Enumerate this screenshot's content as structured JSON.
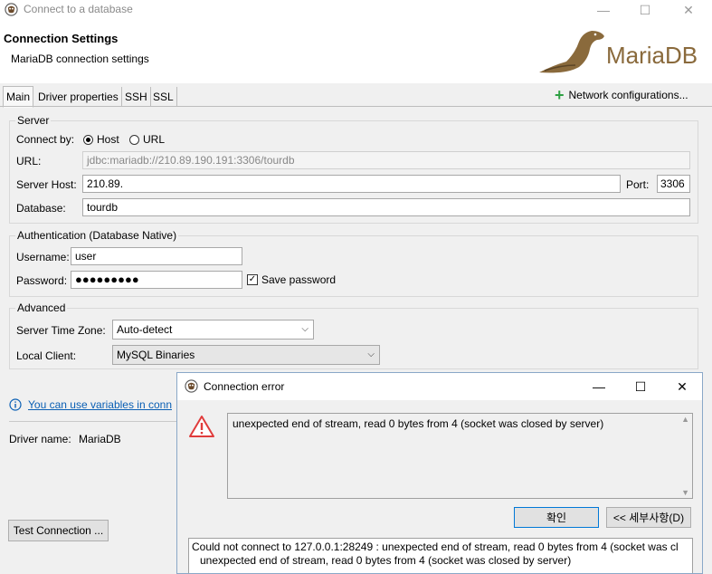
{
  "window": {
    "title": "Connect to a database"
  },
  "header": {
    "title": "Connection Settings",
    "subtitle": "MariaDB connection settings",
    "logo_text": "MariaDB"
  },
  "tabs": [
    {
      "label": "Main"
    },
    {
      "label": "Driver properties"
    },
    {
      "label": "SSH"
    },
    {
      "label": "SSL"
    }
  ],
  "network_config_label": "Network configurations...",
  "server": {
    "group_label": "Server",
    "connect_by_label": "Connect by:",
    "host_option": "Host",
    "url_option": "URL",
    "url_label": "URL:",
    "url_value": "jdbc:mariadb://210.89.190.191:3306/tourdb",
    "host_label": "Server Host:",
    "host_value": "210.89.",
    "port_label": "Port:",
    "port_value": "3306",
    "database_label": "Database:",
    "database_value": "tourdb"
  },
  "auth": {
    "group_label": "Authentication (Database Native)",
    "username_label": "Username:",
    "username_value": "user",
    "password_label": "Password:",
    "password_mask": "●●●●●●●●●",
    "save_password_label": "Save password"
  },
  "advanced": {
    "group_label": "Advanced",
    "timezone_label": "Server Time Zone:",
    "timezone_value": "Auto-detect",
    "client_label": "Local Client:",
    "client_value": "MySQL Binaries"
  },
  "info_text": "You can use variables in conn",
  "driver": {
    "label": "Driver name:",
    "value": "MariaDB"
  },
  "test_button": "Test Connection ...",
  "dialog": {
    "title": "Connection error",
    "message": "unexpected end of stream, read 0 bytes from 4 (socket was closed by server)",
    "ok_button": "확인",
    "details_button": "<< 세부사항(D)",
    "details_line1": "Could not connect to 127.0.0.1:28249 : unexpected end of stream, read 0 bytes from 4 (socket was cl",
    "details_line2": "unexpected end of stream, read 0 bytes from 4 (socket was closed by server)"
  },
  "colors": {
    "warning": "#e03c3c",
    "link": "#0a5fb4",
    "add": "#2ea043",
    "logo": "#8a6a3c"
  }
}
